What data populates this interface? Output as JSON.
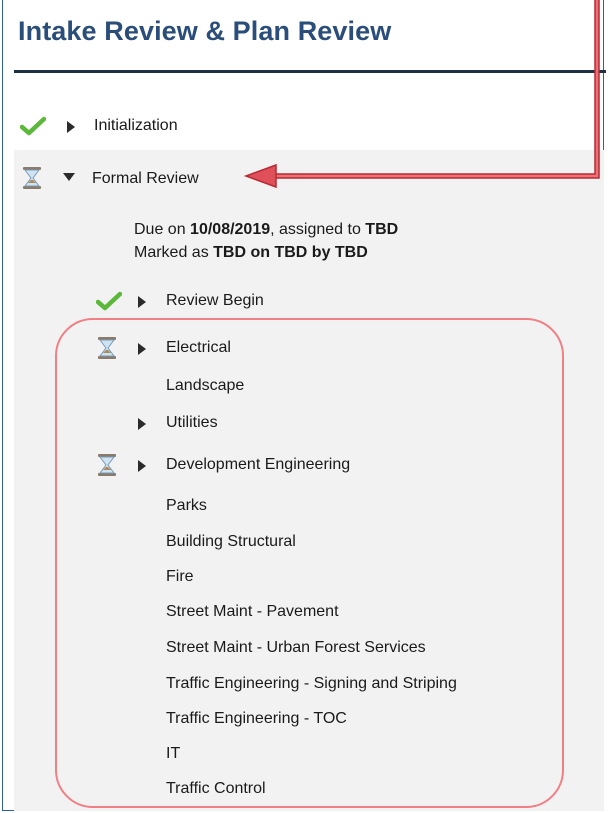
{
  "header": {
    "title": "Intake Review & Plan Review"
  },
  "workflow": {
    "initialization": {
      "label": "Initialization",
      "status_icon": "check-icon"
    },
    "formal_review": {
      "label": "Formal Review",
      "status_icon": "hourglass-icon",
      "detail": {
        "due_prefix": "Due on ",
        "due_date": "10/08/2019",
        "assigned_prefix": ", assigned to ",
        "assigned_to": "TBD",
        "marked_prefix": "Marked as ",
        "marked_as": "TBD on TBD by TBD"
      },
      "tasks": [
        {
          "label": "Review Begin",
          "status_icon": "check-icon",
          "expandable": true
        },
        {
          "label": "Electrical",
          "status_icon": "hourglass-icon",
          "expandable": true
        },
        {
          "label": "Landscape"
        },
        {
          "label": "Utilities",
          "expandable": true
        },
        {
          "label": "Development Engineering",
          "status_icon": "hourglass-icon",
          "expandable": true
        },
        {
          "label": "Parks"
        },
        {
          "label": "Building Structural"
        },
        {
          "label": "Fire"
        },
        {
          "label": "Street Maint - Pavement"
        },
        {
          "label": "Street Maint - Urban Forest Services"
        },
        {
          "label": "Traffic Engineering - Signing and Striping"
        },
        {
          "label": "Traffic Engineering - TOC"
        },
        {
          "label": "IT"
        },
        {
          "label": "Traffic Control"
        }
      ]
    }
  },
  "colors": {
    "title": "#2a4d7a",
    "annotation": "#d9434e",
    "panel": "#f2f2f2",
    "check": "#5cb83a"
  }
}
